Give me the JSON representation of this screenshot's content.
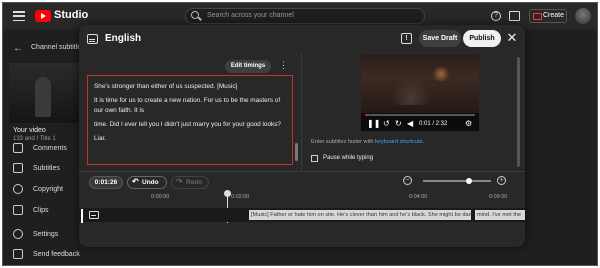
{
  "app": {
    "brand": "Studio",
    "search_placeholder": "Search across your channel",
    "create_label": "Create"
  },
  "sidebar": {
    "channel_subtitles": "Channel subtitles",
    "your_video": "Your video",
    "video_title": "133 and I Title 1",
    "items": [
      {
        "label": "Comments",
        "icon": "comment-icon"
      },
      {
        "label": "Subtitles",
        "icon": "subtitles-icon"
      },
      {
        "label": "Copyright",
        "icon": "copyright-icon"
      },
      {
        "label": "Clips",
        "icon": "scissors-icon"
      },
      {
        "label": "Settings",
        "icon": "gear-icon"
      },
      {
        "label": "Send feedback",
        "icon": "feedback-icon"
      }
    ]
  },
  "modal": {
    "language": "English",
    "save_draft": "Save Draft",
    "publish": "Publish",
    "edit_timings": "Edit timings",
    "subtitle_lines": [
      "She's stronger than either of us suspected. [Music]",
      "It is time for us to create a new nation. For us to be the masters of our own faith. It is",
      "time. Did I ever tell you I didn't just marry you for your good looks?",
      "Liar."
    ],
    "player": {
      "time": "0:01 / 2:32",
      "progress_fraction": 0.01
    },
    "keyboard_hint_prefix": "Enter subtitles faster with ",
    "keyboard_hint_link": "keyboard shortcuts",
    "keyboard_hint_suffix": ".",
    "pause_while_typing": "Pause while typing"
  },
  "timeline": {
    "current_time": "0:01:26",
    "undo": "Undo",
    "redo": "Redo",
    "zoom_fraction": 0.68,
    "ticks": [
      "0:00:00",
      "0:02:00",
      "0:04:00",
      "0:09:00"
    ],
    "cues": [
      "[Music] Father or hate him on site. He's clever  than him and he's black. She might be danger...",
      "mind. I've met the"
    ]
  },
  "colors": {
    "accent_red": "#c4302b",
    "link_blue": "#3ea6ff",
    "brand_red": "#ff0000"
  }
}
